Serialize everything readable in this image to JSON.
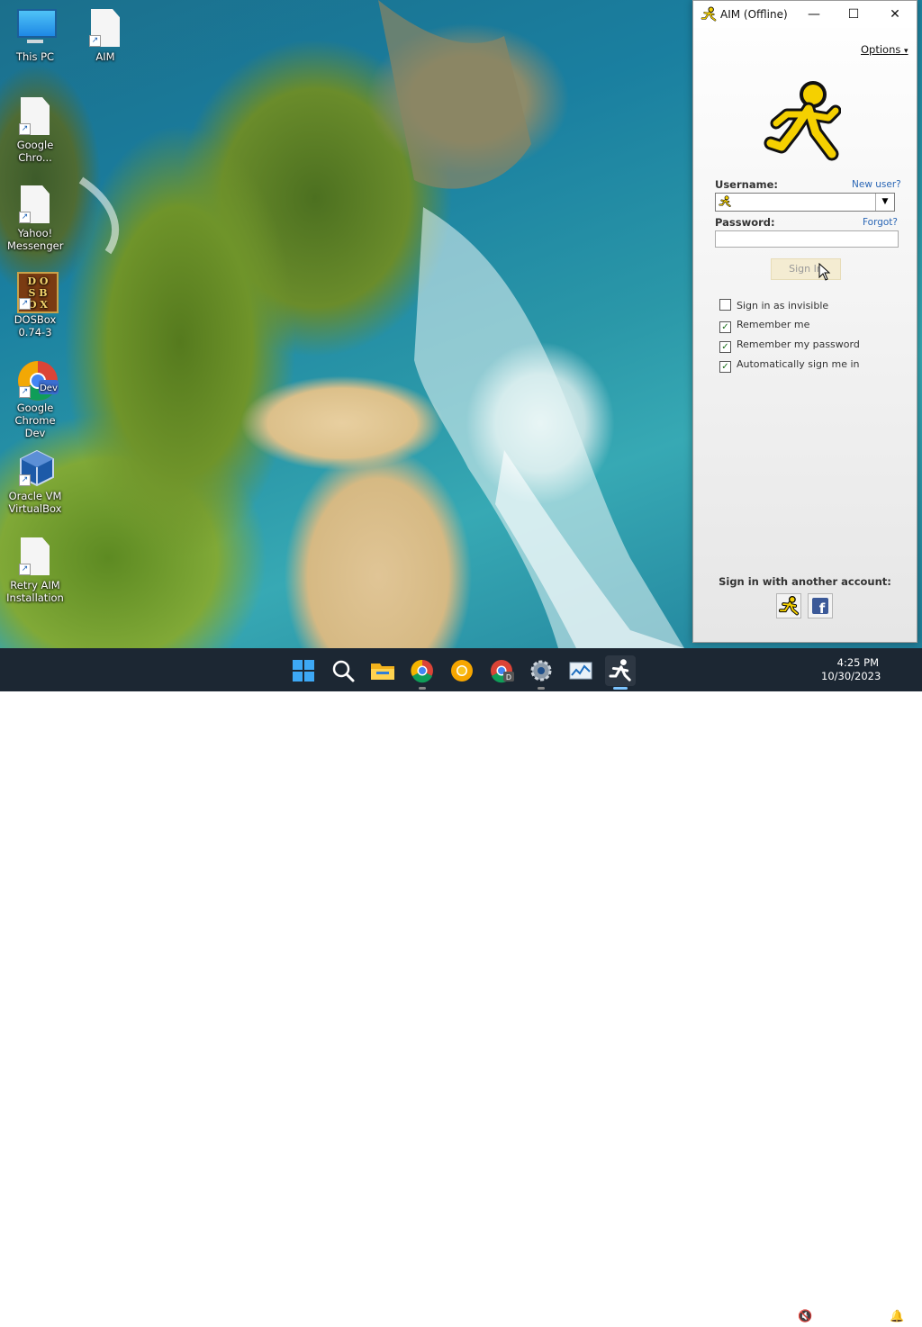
{
  "desktop": {
    "icons": [
      {
        "label": "This PC"
      },
      {
        "label": "AIM"
      },
      {
        "label": "Google Chro..."
      },
      {
        "label": "Yahoo! Messenger"
      },
      {
        "label": "DOSBox 0.74-3"
      },
      {
        "label": "Google Chrome Dev"
      },
      {
        "label": "Oracle VM VirtualBox"
      },
      {
        "label": "Retry AIM Installation"
      }
    ]
  },
  "aim": {
    "title": "AIM (Offline)",
    "options_label": "Options",
    "username_label": "Username:",
    "new_user_link": "New user?",
    "username_value": "",
    "password_label": "Password:",
    "forgot_link": "Forgot?",
    "password_value": "",
    "sign_in_label": "Sign In",
    "checkboxes": [
      {
        "label": "Sign in as invisible",
        "checked": false
      },
      {
        "label": "Remember me",
        "checked": true
      },
      {
        "label": "Remember my password",
        "checked": true
      },
      {
        "label": "Automatically sign me in",
        "checked": true
      }
    ],
    "another_account_label": "Sign in with another account:",
    "brand_color": "#f5d000"
  },
  "taskbar": {
    "apps": [
      "start-icon",
      "search-icon",
      "file-explorer-icon",
      "chrome-icon",
      "chrome-canary-icon",
      "chrome-dev-icon",
      "settings-icon",
      "task-manager-icon",
      "aim-icon"
    ],
    "time": "4:25 PM",
    "date": "10/30/2023",
    "bg_color": "#1c2733"
  }
}
